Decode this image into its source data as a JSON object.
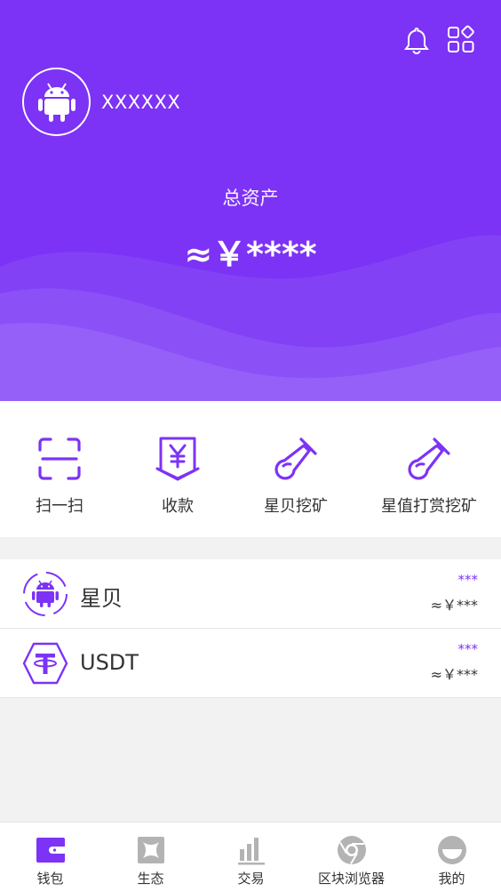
{
  "header": {
    "username": "XXXXXX",
    "total_assets_label": "总资产",
    "total_assets_value": "≈￥****"
  },
  "actions": [
    {
      "label": "扫一扫",
      "icon": "scan-icon"
    },
    {
      "label": "收款",
      "icon": "receive-icon"
    },
    {
      "label": "星贝挖矿",
      "icon": "mining-icon"
    },
    {
      "label": "星值打赏挖矿",
      "icon": "mining-icon"
    }
  ],
  "assets": [
    {
      "name": "星贝",
      "amount": "***",
      "value": "≈￥***",
      "icon": "android-coin-icon"
    },
    {
      "name": "USDT",
      "amount": "***",
      "value": "≈￥***",
      "icon": "tether-icon"
    }
  ],
  "tabs": [
    {
      "label": "钱包",
      "icon": "wallet-icon",
      "active": true
    },
    {
      "label": "生态",
      "icon": "ecosystem-icon",
      "active": false
    },
    {
      "label": "交易",
      "icon": "chart-bars-icon",
      "active": false
    },
    {
      "label": "区块浏览器",
      "icon": "browser-icon",
      "active": false
    },
    {
      "label": "我的",
      "icon": "profile-icon",
      "active": false
    }
  ],
  "colors": {
    "accent": "#7c33f5",
    "inactive_icon": "#b3b3b3",
    "background": "#f2f2f2"
  }
}
